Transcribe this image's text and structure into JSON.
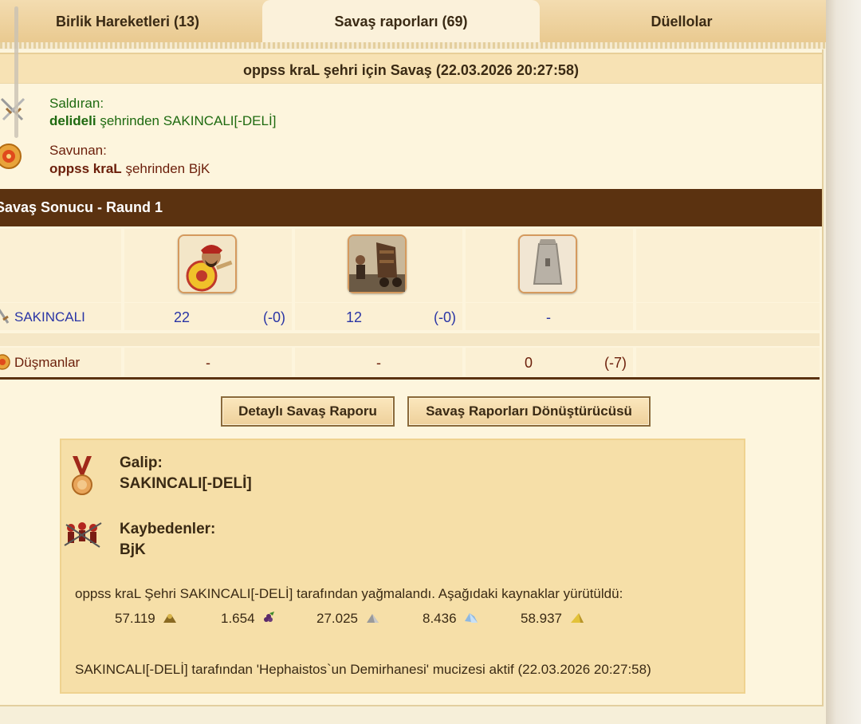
{
  "tabs": [
    {
      "label": "Birlik Hareketleri (13)"
    },
    {
      "label": "Savaş raporları (69)"
    },
    {
      "label": "Düellolar"
    }
  ],
  "report": {
    "title": "oppss kraL şehri için Savaş (22.03.2026 20:27:58)",
    "attacker": {
      "label": "Saldıran:",
      "city": "delideli",
      "from_text": "şehrinden SAKINCALI[-DELİ]"
    },
    "defender": {
      "label": "Savunan:",
      "city": "oppss kraL",
      "from_text": "şehrinden BjK"
    },
    "section_title": "Savaş Sonucu - Raund 1",
    "rows": [
      {
        "name": "SAKINCALI",
        "cells": [
          "22",
          "(-0)",
          "12",
          "(-0)",
          "-"
        ]
      },
      {
        "name": "Düşmanlar",
        "cells": [
          "-",
          "-",
          "0",
          "(-7)"
        ]
      }
    ],
    "units": [
      "greek-hoplite-unit",
      "siege-unit",
      "stone-tower-unit"
    ]
  },
  "buttons": {
    "detailed": "Detaylı Savaş Raporu",
    "converter": "Savaş Raporları Dönüştürücüsü"
  },
  "result": {
    "winner_label": "Galip:",
    "winner": "SAKINCALI[-DELİ]",
    "losers_label": "Kaybedenler:",
    "loser": "BjK",
    "plunder_text": "oppss kraL Şehri SAKINCALI[-DELİ] tarafından yağmalandı. Aşağıdaki kaynaklar yürütüldü:",
    "resources": [
      {
        "value": "57.119",
        "icon": "wood-icon"
      },
      {
        "value": "1.654",
        "icon": "wine-icon"
      },
      {
        "value": "27.025",
        "icon": "marble-icon"
      },
      {
        "value": "8.436",
        "icon": "crystal-icon"
      },
      {
        "value": "58.937",
        "icon": "sulfur-icon"
      }
    ],
    "wonder_text": "SAKINCALI[-DELİ] tarafından 'Hephaistos`un Demirhanesi' mucizesi aktif (22.03.2026 20:27:58)"
  }
}
